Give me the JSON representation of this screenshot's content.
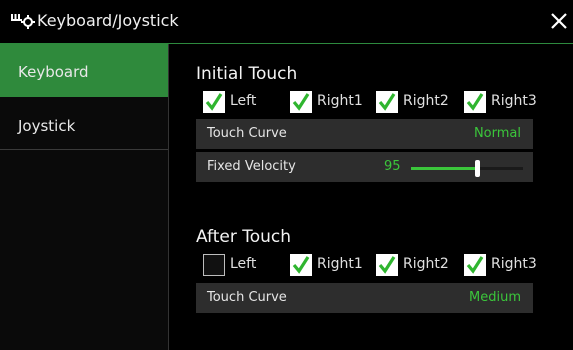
{
  "header": {
    "title": "Keyboard/Joystick",
    "icon": "keyboard-joystick-icon",
    "close_icon": "close-icon"
  },
  "sidebar": {
    "items": [
      {
        "label": "Keyboard",
        "active": true
      },
      {
        "label": "Joystick",
        "active": false
      }
    ]
  },
  "initial_touch": {
    "title": "Initial Touch",
    "checkboxes": [
      {
        "label": "Left",
        "checked": true
      },
      {
        "label": "Right1",
        "checked": true
      },
      {
        "label": "Right2",
        "checked": true
      },
      {
        "label": "Right3",
        "checked": true
      }
    ],
    "touch_curve": {
      "label": "Touch Curve",
      "value": "Normal"
    },
    "fixed_velocity": {
      "label": "Fixed Velocity",
      "value": "95",
      "min": 1,
      "max": 127
    }
  },
  "after_touch": {
    "title": "After Touch",
    "checkboxes": [
      {
        "label": "Left",
        "checked": false
      },
      {
        "label": "Right1",
        "checked": true
      },
      {
        "label": "Right2",
        "checked": true
      },
      {
        "label": "Right3",
        "checked": true
      }
    ],
    "touch_curve": {
      "label": "Touch Curve",
      "value": "Medium"
    }
  },
  "colors": {
    "accent": "#2f8a3c",
    "value_green": "#3bc63b",
    "check_green": "#2fb52f"
  }
}
